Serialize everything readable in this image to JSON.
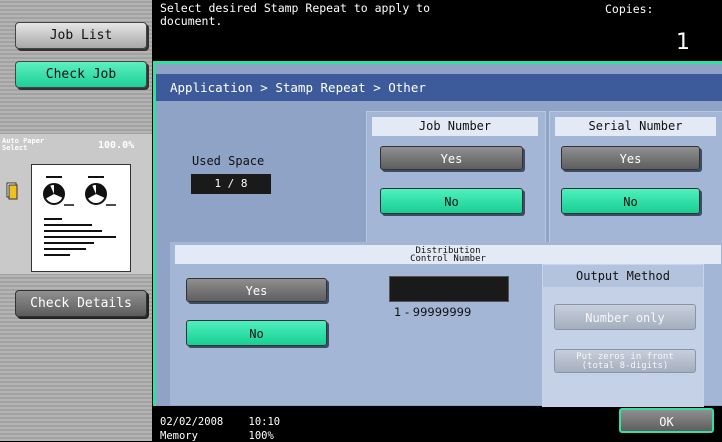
{
  "left_panel": {
    "job_list": "Job List",
    "check_job": "Check Job",
    "paper_label": "Auto Paper\nSelect",
    "zoom": "100.0%",
    "check_details": "Check Details"
  },
  "header": {
    "message": "Select desired Stamp Repeat to apply to\ndocument.",
    "copies_label": "Copies:",
    "copies_value": "1"
  },
  "breadcrumb": "Application > Stamp Repeat > Other",
  "used_space": {
    "label": "Used Space",
    "value": "1 / 8"
  },
  "job_number": {
    "title": "Job Number",
    "yes": "Yes",
    "no": "No",
    "selected": "No"
  },
  "serial_number": {
    "title": "Serial Number",
    "yes": "Yes",
    "no": "No",
    "selected": "No"
  },
  "distribution": {
    "title": "Distribution\nControl Number",
    "yes": "Yes",
    "no": "No",
    "selected": "No",
    "range": "1  -  99999999"
  },
  "output_method": {
    "title": "Output Method",
    "number_only": "Number only",
    "zeros": "Put zeros in front\n(total 8-digits)"
  },
  "footer": {
    "datetime": "02/02/2008    10:10",
    "memory": "Memory        100%",
    "ok": "OK"
  },
  "colors": {
    "accent_green": "#1fcf96",
    "panel_blue": "#8fa3c7",
    "breadcrumb_blue": "#3d5b9a"
  }
}
